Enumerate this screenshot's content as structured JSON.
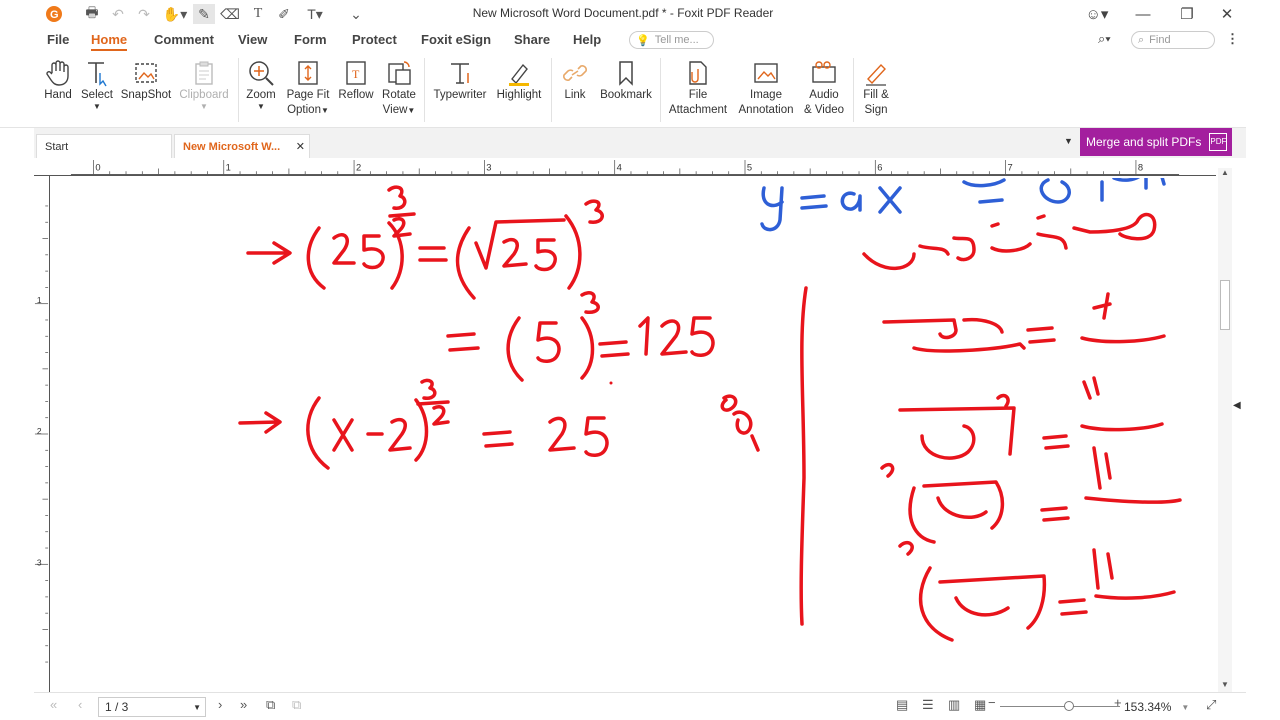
{
  "window": {
    "title": "New Microsoft Word Document.pdf * - Foxit PDF Reader"
  },
  "menu": [
    "File",
    "Home",
    "Comment",
    "View",
    "Form",
    "Protect",
    "Foxit eSign",
    "Share",
    "Help"
  ],
  "tellme_placeholder": "Tell me...",
  "find_placeholder": "Find",
  "ribbon": {
    "hand": "Hand",
    "select": "Select",
    "snapshot": "SnapShot",
    "clipboard": "Clipboard",
    "zoom": "Zoom",
    "pagefit_1": "Page Fit",
    "pagefit_2": "Option",
    "reflow": "Reflow",
    "rotate_1": "Rotate",
    "rotate_2": "View",
    "typewriter": "Typewriter",
    "highlight": "Highlight",
    "link": "Link",
    "bookmark": "Bookmark",
    "file_att_1": "File",
    "file_att_2": "Attachment",
    "image_ann_1": "Image",
    "image_ann_2": "Annotation",
    "audio_1": "Audio",
    "audio_2": "& Video",
    "fill_1": "Fill &",
    "fill_2": "Sign"
  },
  "tabs": {
    "start": "Start",
    "doc": "New Microsoft W..."
  },
  "merge_button": "Merge and split PDFs",
  "ruler": [
    "0",
    "1",
    "2",
    "3",
    "4",
    "5",
    "6",
    "7",
    "8"
  ],
  "vruler": [
    "1",
    "2",
    "3"
  ],
  "status": {
    "page": "1 / 3",
    "zoom": "153.34%"
  },
  "colors": {
    "accent": "#e0661c",
    "merge": "#a31f9e",
    "ink_red": "#e8141c",
    "ink_blue": "#2e5fd6"
  }
}
